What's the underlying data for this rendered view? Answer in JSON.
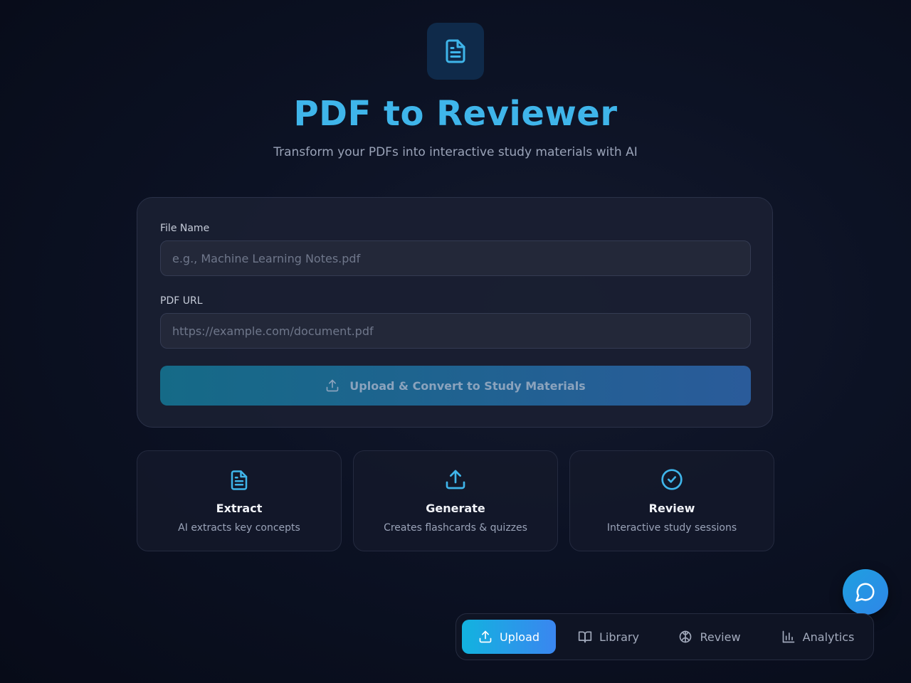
{
  "header": {
    "logo_icon": "file-text-icon",
    "title": "PDF to Reviewer",
    "subtitle": "Transform your PDFs into interactive study materials with AI"
  },
  "form": {
    "file_name_label": "File Name",
    "file_name_placeholder": "e.g., Machine Learning Notes.pdf",
    "file_name_value": "",
    "pdf_url_label": "PDF URL",
    "pdf_url_placeholder": "https://example.com/document.pdf",
    "pdf_url_value": "",
    "submit_label": "Upload & Convert to Study Materials",
    "submit_icon": "upload-icon"
  },
  "features": [
    {
      "icon": "file-text-icon",
      "title": "Extract",
      "description": "AI extracts key concepts"
    },
    {
      "icon": "upload-icon",
      "title": "Generate",
      "description": "Creates flashcards & quizzes"
    },
    {
      "icon": "check-circle-icon",
      "title": "Review",
      "description": "Interactive study sessions"
    }
  ],
  "chat": {
    "icon": "chat-bubble-icon"
  },
  "nav": {
    "items": [
      {
        "label": "Upload",
        "icon": "upload-icon",
        "active": true
      },
      {
        "label": "Library",
        "icon": "book-open-icon",
        "active": false
      },
      {
        "label": "Review",
        "icon": "brain-icon",
        "active": false
      },
      {
        "label": "Analytics",
        "icon": "bar-chart-icon",
        "active": false
      }
    ]
  },
  "colors": {
    "accent": "#3fb5ea",
    "nav_active_start": "#12b3df",
    "nav_active_end": "#3a86f0",
    "background": "#0c1224"
  }
}
